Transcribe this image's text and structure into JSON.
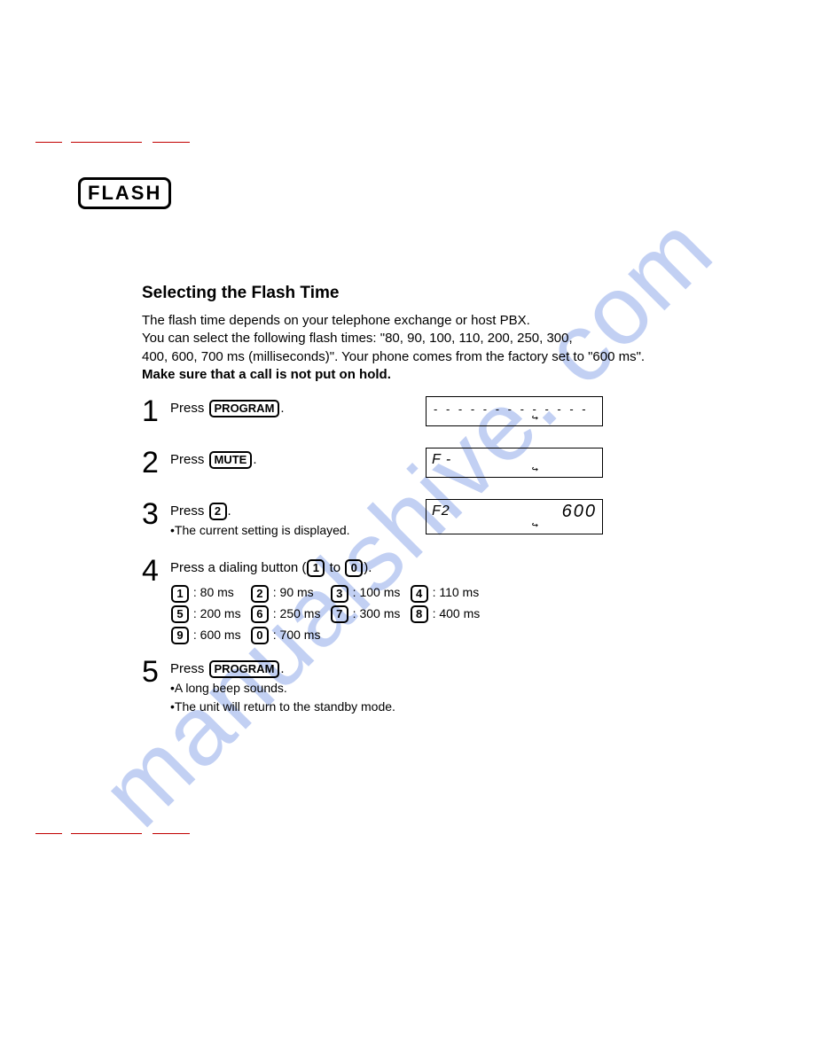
{
  "watermark": "manualshive. com",
  "flash_label": "FLASH",
  "title": "Selecting the Flash Time",
  "intro_line1": "The flash time depends on your telephone exchange or host PBX.",
  "intro_line2": "You can select the following flash times: \"80, 90, 100, 110, 200, 250, 300,",
  "intro_line3": "400, 600, 700 ms (milliseconds)\". Your phone comes from the factory set to \"600 ms\".",
  "intro_line4": "Make sure that a call is not put on hold",
  "steps": {
    "s1": {
      "num": "1",
      "press": "Press",
      "key": "PROGRAM",
      "dot": "."
    },
    "s2": {
      "num": "2",
      "press": "Press",
      "key": "MUTE",
      "dot": ".",
      "lcd_left": "F -"
    },
    "s3": {
      "num": "3",
      "press": "Press",
      "key": "2",
      "dot": ".",
      "note": "The current setting is displayed.",
      "lcd_left": "F2",
      "lcd_right": "600"
    },
    "s4": {
      "num": "4",
      "line": "Press a dialing button (",
      "range_a": "1",
      "range_to": "to",
      "range_b": "0",
      "line_end": ").",
      "opts": [
        {
          "k": "1",
          "v": ": 80 ms"
        },
        {
          "k": "2",
          "v": ": 90 ms"
        },
        {
          "k": "3",
          "v": ": 100 ms"
        },
        {
          "k": "4",
          "v": ": 110 ms"
        },
        {
          "k": "5",
          "v": ": 200 ms"
        },
        {
          "k": "6",
          "v": ": 250 ms"
        },
        {
          "k": "7",
          "v": ": 300 ms"
        },
        {
          "k": "8",
          "v": ": 400 ms"
        },
        {
          "k": "9",
          "v": ": 600 ms"
        },
        {
          "k": "0",
          "v": ": 700 ms"
        }
      ]
    },
    "s5": {
      "num": "5",
      "press": "Press",
      "key": "PROGRAM",
      "dot": ".",
      "note1": "A long beep sounds.",
      "note2": "The unit will return to the standby mode."
    }
  },
  "arrow_glyph": "↪"
}
